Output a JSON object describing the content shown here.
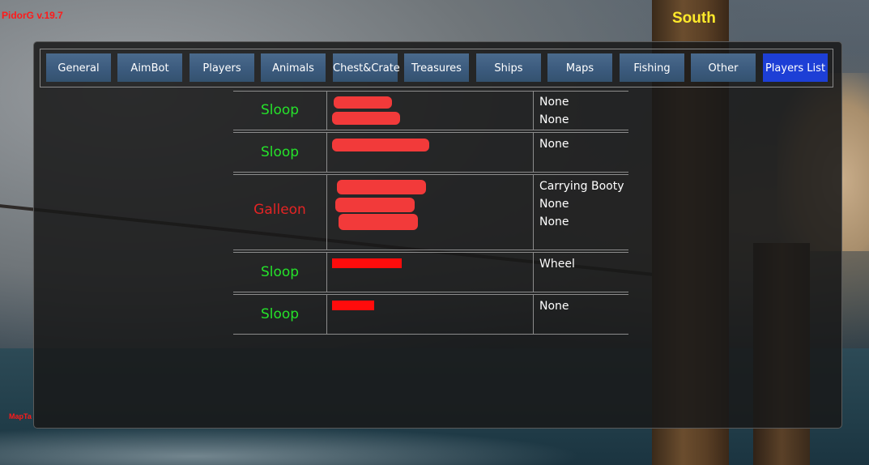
{
  "overlay": {
    "version": "PidorG v.19.7",
    "compass": "South",
    "map_label": "MapTa"
  },
  "tabs": [
    {
      "label": "General",
      "active": false
    },
    {
      "label": "AimBot",
      "active": false
    },
    {
      "label": "Players",
      "active": false
    },
    {
      "label": "Animals",
      "active": false
    },
    {
      "label": "Chest&Crate",
      "active": false
    },
    {
      "label": "Treasures",
      "active": false
    },
    {
      "label": "Ships",
      "active": false
    },
    {
      "label": "Maps",
      "active": false
    },
    {
      "label": "Fishing",
      "active": false
    },
    {
      "label": "Other",
      "active": false
    },
    {
      "label": "Players List",
      "active": true
    }
  ],
  "crews": [
    {
      "ship": "Sloop",
      "ship_color": "#25e12a",
      "statuses": [
        "None",
        "None"
      ]
    },
    {
      "ship": "Sloop",
      "ship_color": "#25e12a",
      "statuses": [
        "None"
      ]
    },
    {
      "ship": "Galleon",
      "ship_color": "#e42424",
      "statuses": [
        "Carrying Booty",
        "None",
        "None"
      ]
    },
    {
      "ship": "Sloop",
      "ship_color": "#25e12a",
      "statuses": [
        "Wheel"
      ]
    },
    {
      "ship": "Sloop",
      "ship_color": "#25e12a",
      "statuses": [
        "None"
      ]
    }
  ],
  "colors": {
    "active_tab": "#1d3fd6",
    "tab": "#3b5a7d",
    "sloop": "#25e12a",
    "galleon": "#e42424"
  }
}
